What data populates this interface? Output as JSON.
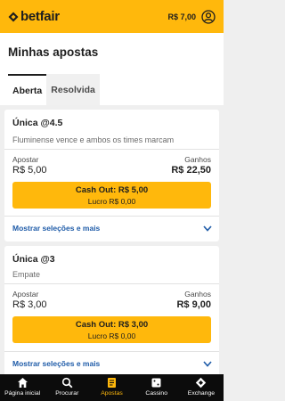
{
  "header": {
    "brand": "betfair",
    "balance": "R$ 7,00"
  },
  "page": {
    "title": "Minhas apostas",
    "tabs": [
      {
        "label": "Aberta",
        "active": true
      },
      {
        "label": "Resolvida",
        "active": false
      }
    ]
  },
  "bets": [
    {
      "title": "Única @4.5",
      "description": "Fluminense vence e ambos os times marcam",
      "stake_label": "Apostar",
      "stake": "R$ 5,00",
      "returns_label": "Ganhos",
      "returns": "R$ 22,50",
      "cashout_label": "Cash Out: R$ 5,00",
      "profit_label": "Lucro R$ 0,00",
      "more_label": "Mostrar seleções e mais"
    },
    {
      "title": "Única @3",
      "description": "Empate",
      "stake_label": "Apostar",
      "stake": "R$ 3,00",
      "returns_label": "Ganhos",
      "returns": "R$ 9,00",
      "cashout_label": "Cash Out: R$ 3,00",
      "profit_label": "Lucro R$ 0,00",
      "more_label": "Mostrar seleções e mais"
    }
  ],
  "nav": [
    {
      "label": "Página inicial",
      "icon": "home-icon",
      "active": false
    },
    {
      "label": "Procurar",
      "icon": "search-icon",
      "active": false
    },
    {
      "label": "Apostas",
      "icon": "bets-icon",
      "active": true
    },
    {
      "label": "Cassino",
      "icon": "casino-icon",
      "active": false
    },
    {
      "label": "Exchange",
      "icon": "exchange-icon",
      "active": false
    }
  ],
  "colors": {
    "brand_yellow": "#ffb80c",
    "link_blue": "#1e5ba8",
    "nav_bg": "#0c0c0c"
  }
}
